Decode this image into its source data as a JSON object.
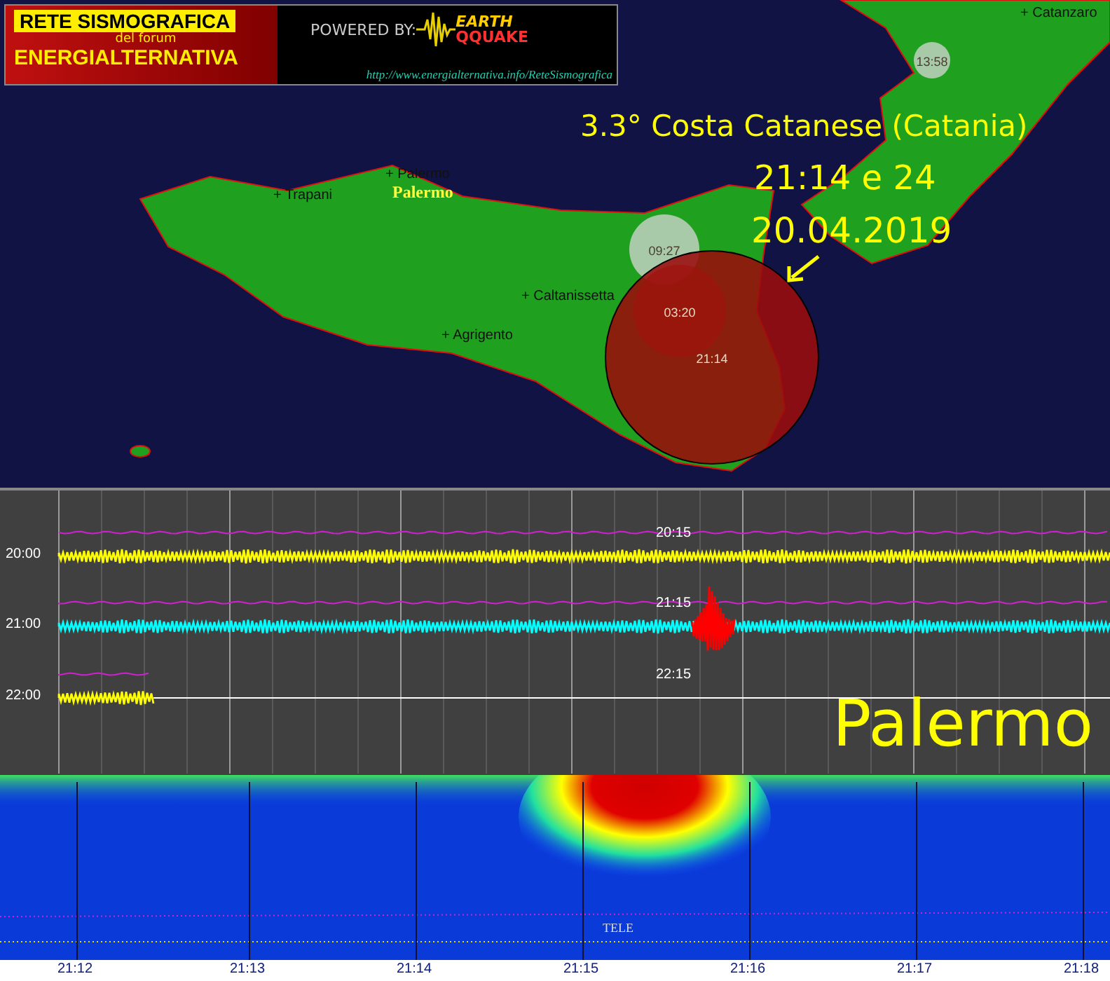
{
  "banner": {
    "title": "RETE SISMOGRAFICA",
    "subtitle": "del forum",
    "brand": "ENERGIALTERNATIVA",
    "powered_by": "POWERED BY:",
    "logo_line_1": "EARTH",
    "logo_line_2": "QQUAKE",
    "url": "http://www.energialternativa.info/ReteSismografica"
  },
  "map": {
    "headline": "3.3° Costa Catanese (Catania)",
    "time": "21:14 e 24",
    "date": "20.04.2019",
    "station": "Palermo",
    "places": [
      {
        "name": "+ Catanzaro"
      },
      {
        "name": "+ Palermo"
      },
      {
        "name": "+ Trapani"
      },
      {
        "name": "+ Caltanissetta"
      },
      {
        "name": "+ Agrigento"
      }
    ],
    "events": [
      {
        "time": "13:58",
        "kind": "past"
      },
      {
        "time": "09:27",
        "kind": "past"
      },
      {
        "time": "03:20",
        "kind": "recent"
      },
      {
        "time": "21:14",
        "kind": "current"
      }
    ]
  },
  "seismogram": {
    "station": "Palermo",
    "rows": [
      {
        "hour": "20:00",
        "mark": "20:15",
        "color": "#ffff00",
        "level": 1,
        "event": false
      },
      {
        "hour": "21:00",
        "mark": "21:15",
        "color": "#00ffff",
        "level": 1,
        "event": true
      },
      {
        "hour": "22:00",
        "mark": "22:15",
        "color": "#ffff00",
        "level": 0.09,
        "event": false
      }
    ]
  },
  "spectrogram": {
    "label": "TELE",
    "times": [
      "21:12",
      "21:13",
      "21:14",
      "21:15",
      "21:16",
      "21:17",
      "21:18"
    ]
  }
}
